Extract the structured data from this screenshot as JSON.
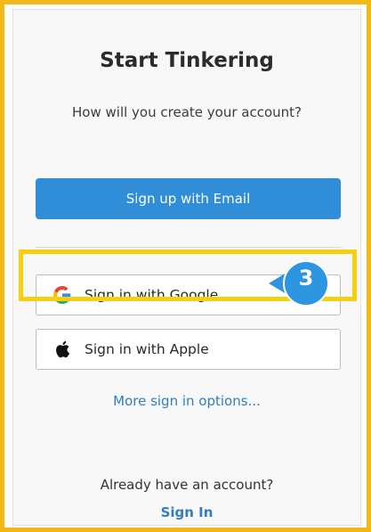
{
  "dialog": {
    "title": "Start Tinkering",
    "subtitle": "How will you create your account?",
    "email_button": "Sign up with Email",
    "google_button": "Sign in with Google",
    "apple_button": "Sign in with Apple",
    "more_options": "More sign in options...",
    "already_have_account": "Already have an account?",
    "sign_in_link": "Sign In"
  },
  "annotation": {
    "step_number": "3"
  },
  "colors": {
    "frame_border": "#f3b719",
    "highlight_border": "#f5cf10",
    "primary_button": "#2f8ed7",
    "link": "#2f7fc1",
    "badge": "#2e95e0"
  },
  "icons": {
    "google": "google-icon",
    "apple": "apple-icon"
  }
}
